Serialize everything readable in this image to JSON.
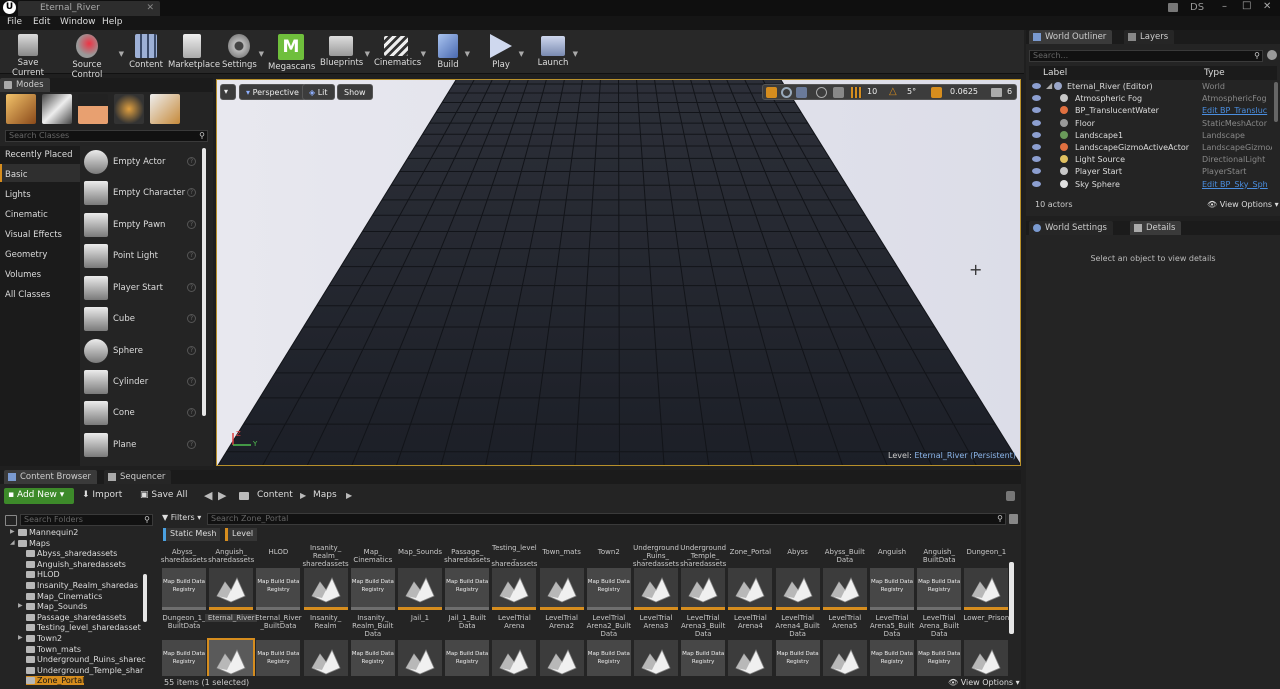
{
  "window": {
    "tab": "Eternal_River",
    "user_badge": "DS",
    "min": "–",
    "max": "□",
    "close": "✕"
  },
  "menu": [
    "File",
    "Edit",
    "Window",
    "Help"
  ],
  "toolbar": [
    {
      "label": "Save Current",
      "icon": "save-icon"
    },
    {
      "label": "Source Control",
      "icon": "source-control-icon"
    },
    {
      "label": "Content",
      "icon": "content-icon"
    },
    {
      "label": "Marketplace",
      "icon": "marketplace-icon"
    },
    {
      "label": "Settings",
      "icon": "gear-icon"
    },
    {
      "label": "Megascans",
      "icon": "megascans-icon"
    },
    {
      "label": "Blueprints",
      "icon": "blueprints-icon"
    },
    {
      "label": "Cinematics",
      "icon": "clapper-icon"
    },
    {
      "label": "Build",
      "icon": "build-icon"
    },
    {
      "label": "Play",
      "icon": "play-icon"
    },
    {
      "label": "Launch",
      "icon": "launch-icon"
    }
  ],
  "modes": {
    "tab": "Modes",
    "search_placeholder": "Search Classes",
    "categories": [
      "Recently Placed",
      "Basic",
      "Lights",
      "Cinematic",
      "Visual Effects",
      "Geometry",
      "Volumes",
      "All Classes"
    ],
    "selected_category": "Basic",
    "items": [
      "Empty Actor",
      "Empty Character",
      "Empty Pawn",
      "Point Light",
      "Player Start",
      "Cube",
      "Sphere",
      "Cylinder",
      "Cone",
      "Plane"
    ],
    "help": "?"
  },
  "viewport": {
    "perspective": "Perspective",
    "lit": "Lit",
    "show": "Show",
    "grid_snap": "10",
    "rotation_snap": "5°",
    "scale_snap": "0.0625",
    "camera_speed": "6",
    "level_label": "Level:",
    "level_name": "Eternal_River (Persistent)",
    "axis_z": "Z",
    "axis_y": "Y"
  },
  "outliner": {
    "tab": "World Outliner",
    "tab2": "Layers",
    "search_placeholder": "Search...",
    "col_label": "Label",
    "col_type": "Type",
    "rows": [
      {
        "label": "Eternal_River (Editor)",
        "type": "World",
        "link": false,
        "icon": "world-icon",
        "color": "#9aa6c8"
      },
      {
        "label": "Atmospheric Fog",
        "type": "AtmosphericFog",
        "link": false,
        "icon": "fog-icon",
        "color": "#c8c8c8"
      },
      {
        "label": "BP_TranslucentWater",
        "type": "Edit BP_Transluc",
        "link": true,
        "icon": "blueprint-icon",
        "color": "#e07040"
      },
      {
        "label": "Floor",
        "type": "StaticMeshActor",
        "link": false,
        "icon": "mesh-icon",
        "color": "#9a9a9a"
      },
      {
        "label": "Landscape1",
        "type": "Landscape",
        "link": false,
        "icon": "landscape-icon",
        "color": "#6a9a5a"
      },
      {
        "label": "LandscapeGizmoActiveActor",
        "type": "LandscapeGizmoA",
        "link": false,
        "icon": "gizmo-icon",
        "color": "#e07040"
      },
      {
        "label": "Light Source",
        "type": "DirectionalLight",
        "link": false,
        "icon": "light-icon",
        "color": "#e0c060"
      },
      {
        "label": "Player Start",
        "type": "PlayerStart",
        "link": false,
        "icon": "player-start-icon",
        "color": "#c8c8c8"
      },
      {
        "label": "Sky Sphere",
        "type": "Edit BP_Sky_Sph",
        "link": true,
        "icon": "sphere-icon",
        "color": "#e0e0e0"
      }
    ],
    "count": "10 actors",
    "view_options": "View Options"
  },
  "details": {
    "tab1": "World Settings",
    "tab2": "Details",
    "empty": "Select an object to view details"
  },
  "content_browser": {
    "tab1": "Content Browser",
    "tab2": "Sequencer",
    "add_new": "Add New",
    "import": "Import",
    "save_all": "Save All",
    "path": [
      "Content",
      "Maps"
    ],
    "search_folders": "Search Folders",
    "filters": "Filters",
    "search_assets": "Search Zone_Portal",
    "filter_chips": [
      "Static Mesh",
      "Level"
    ],
    "folders": [
      {
        "name": "Mannequin2",
        "indent": 0,
        "arrow": "▶"
      },
      {
        "name": "Maps",
        "indent": 0,
        "arrow": "◢"
      },
      {
        "name": "Abyss_sharedassets",
        "indent": 1,
        "arrow": ""
      },
      {
        "name": "Anguish_sharedassets",
        "indent": 1,
        "arrow": ""
      },
      {
        "name": "HLOD",
        "indent": 1,
        "arrow": ""
      },
      {
        "name": "Insanity_Realm_sharedas",
        "indent": 1,
        "arrow": ""
      },
      {
        "name": "Map_Cinematics",
        "indent": 1,
        "arrow": ""
      },
      {
        "name": "Map_Sounds",
        "indent": 1,
        "arrow": "▶"
      },
      {
        "name": "Passage_sharedassets",
        "indent": 1,
        "arrow": ""
      },
      {
        "name": "Testing_level_sharedasset",
        "indent": 1,
        "arrow": ""
      },
      {
        "name": "Town2",
        "indent": 1,
        "arrow": "▶"
      },
      {
        "name": "Town_mats",
        "indent": 1,
        "arrow": ""
      },
      {
        "name": "Underground_Ruins_sharec",
        "indent": 1,
        "arrow": ""
      },
      {
        "name": "Underground_Temple_shar",
        "indent": 1,
        "arrow": ""
      },
      {
        "name": "Zone_Portal",
        "indent": 1,
        "arrow": ""
      }
    ],
    "selected_folder": "Zone_Portal",
    "row1_names": [
      "Abyss_\nsharedassets",
      "Anguish_\nsharedassets",
      "HLOD",
      "Insanity_\nRealm_\nsharedassets",
      "Map_\nCinematics",
      "Map_Sounds",
      "Passage_\nsharedassets",
      "Testing_level\n_\nsharedassets",
      "Town_mats",
      "Town2",
      "Underground\n_Ruins_\nsharedassets",
      "Underground\n_Temple_\nsharedassets",
      "Zone_Portal",
      "Abyss",
      "Abyss_Built\nData",
      "Anguish",
      "Anguish_\nBuiltData",
      "Dungeon_1"
    ],
    "row1_kind": [
      "reg",
      "map",
      "reg",
      "map",
      "reg",
      "map",
      "reg",
      "map",
      "map",
      "reg",
      "map",
      "map",
      "map",
      "map",
      "map",
      "reg",
      "reg",
      "map"
    ],
    "row2_names": [
      "Dungeon_1_\nBuiltData",
      "Eternal_River",
      "Eternal_River\n_BuiltData",
      "Insanity_\nRealm",
      "Insanity_\nRealm_Built\nData",
      "Jail_1",
      "Jail_1_Built\nData",
      "LevelTrial\nArena",
      "LevelTrial\nArena2",
      "LevelTrial\nArena2_Built\nData",
      "LevelTrial\nArena3",
      "LevelTrial\nArena3_Built\nData",
      "LevelTrial\nArena4",
      "LevelTrial\nArena4_Built\nData",
      "LevelTrial\nArena5",
      "LevelTrial\nArena5_Built\nData",
      "LevelTrial\nArena_Built\nData",
      "Lower_Prison"
    ],
    "row3_kind": [
      "reg",
      "map",
      "reg",
      "map",
      "reg",
      "map",
      "reg",
      "map",
      "map",
      "reg",
      "map",
      "reg",
      "map",
      "reg",
      "map",
      "reg",
      "reg",
      "map"
    ],
    "selected_asset": "Eternal_River",
    "registry_label": "Map Build\nData Registry",
    "item_count": "55 items (1 selected)",
    "view_options": "View Options"
  }
}
